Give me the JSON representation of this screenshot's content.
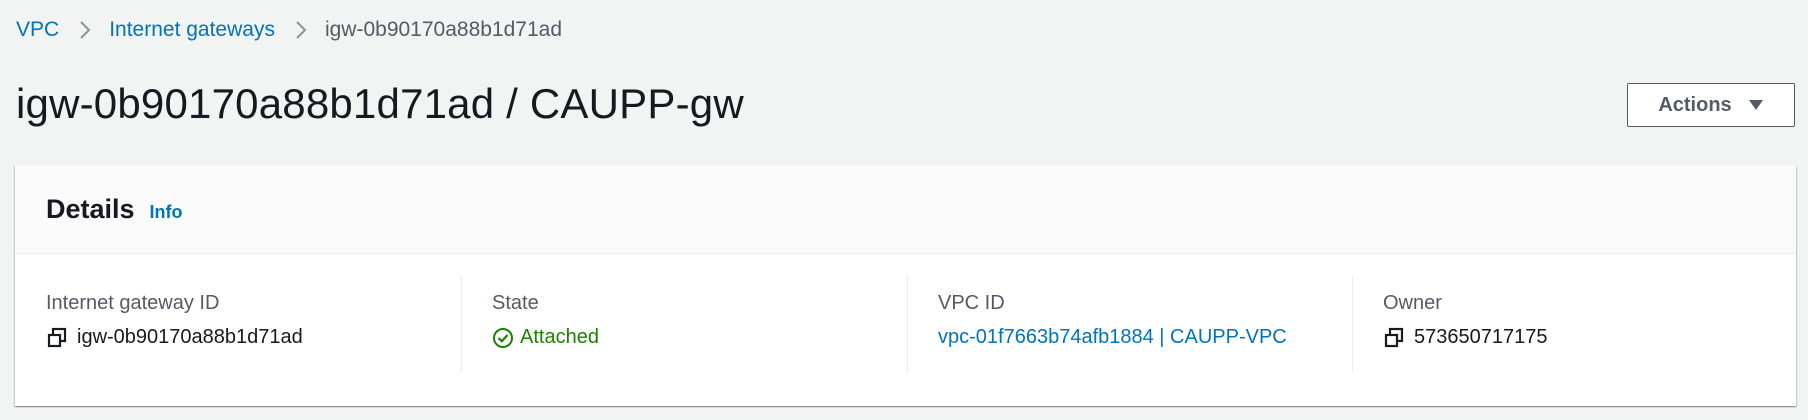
{
  "breadcrumb": {
    "items": [
      {
        "label": "VPC",
        "link": true
      },
      {
        "label": "Internet gateways",
        "link": true
      },
      {
        "label": "igw-0b90170a88b1d71ad",
        "link": false
      }
    ]
  },
  "page": {
    "title": "igw-0b90170a88b1d71ad / CAUPP-gw"
  },
  "actions": {
    "label": "Actions"
  },
  "details": {
    "title": "Details",
    "info_label": "Info",
    "fields": [
      {
        "label": "Internet gateway ID",
        "value": "igw-0b90170a88b1d71ad",
        "icon": "copy-icon"
      },
      {
        "label": "State",
        "value": "Attached",
        "icon": "status-positive-icon"
      },
      {
        "label": "VPC ID",
        "value": "vpc-01f7663b74afb1884 | CAUPP-VPC",
        "icon": null
      },
      {
        "label": "Owner",
        "value": "573650717175",
        "icon": "copy-icon"
      }
    ]
  },
  "colors": {
    "link": "#0073bb",
    "success": "#1d8102",
    "text": "#16191f",
    "secondary_text": "#545b64",
    "background": "#f2f3f3"
  }
}
